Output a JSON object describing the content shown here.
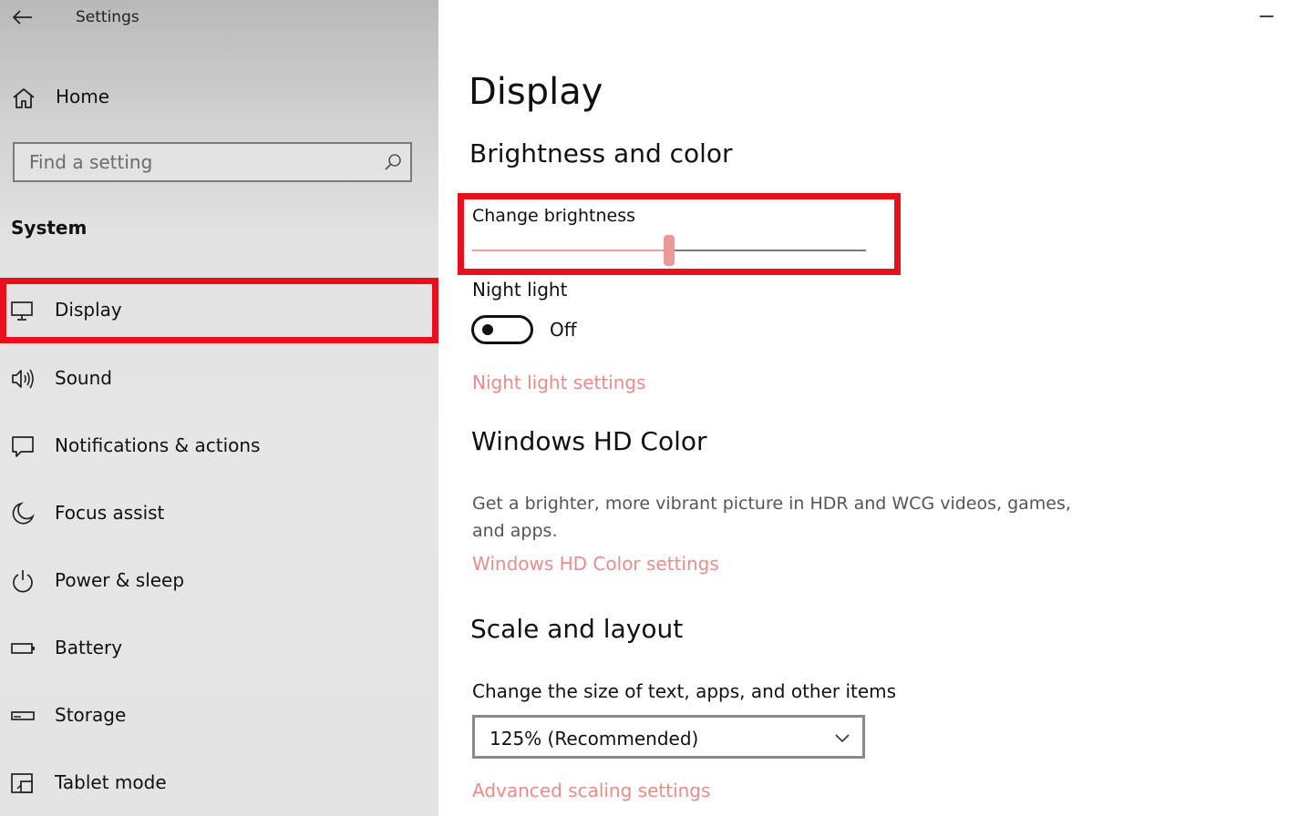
{
  "window": {
    "app_title": "Settings",
    "back_icon": "arrow-left-icon",
    "minimize_icon": "minimize-icon"
  },
  "sidebar": {
    "home_label": "Home",
    "home_icon": "home-icon",
    "search": {
      "placeholder": "Find a setting",
      "value": "",
      "icon": "search-icon"
    },
    "section_label": "System",
    "items": [
      {
        "label": "Display",
        "icon": "monitor-icon",
        "selected": true
      },
      {
        "label": "Sound",
        "icon": "speaker-icon",
        "selected": false
      },
      {
        "label": "Notifications & actions",
        "icon": "notification-icon",
        "selected": false
      },
      {
        "label": "Focus assist",
        "icon": "moon-icon",
        "selected": false
      },
      {
        "label": "Power & sleep",
        "icon": "power-icon",
        "selected": false
      },
      {
        "label": "Battery",
        "icon": "battery-icon",
        "selected": false
      },
      {
        "label": "Storage",
        "icon": "storage-icon",
        "selected": false
      },
      {
        "label": "Tablet mode",
        "icon": "tablet-icon",
        "selected": false
      }
    ],
    "highlight_color": "#e8101d"
  },
  "main": {
    "page_title": "Display",
    "brightness_section": {
      "heading": "Brightness and color",
      "brightness_label": "Change brightness",
      "brightness_value": 50,
      "highlight_color": "#e8101d"
    },
    "night_light": {
      "label": "Night light",
      "state_text": "Off",
      "enabled": false,
      "settings_link": "Night light settings"
    },
    "hd_color": {
      "heading": "Windows HD Color",
      "description": "Get a brighter, more vibrant picture in HDR and WCG videos, games, and apps.",
      "settings_link": "Windows HD Color settings"
    },
    "scale_layout": {
      "heading": "Scale and layout",
      "size_label": "Change the size of text, apps, and other items",
      "selected_scale": "125% (Recommended)",
      "advanced_link": "Advanced scaling settings"
    },
    "accent_color": "#ef8a8a"
  }
}
